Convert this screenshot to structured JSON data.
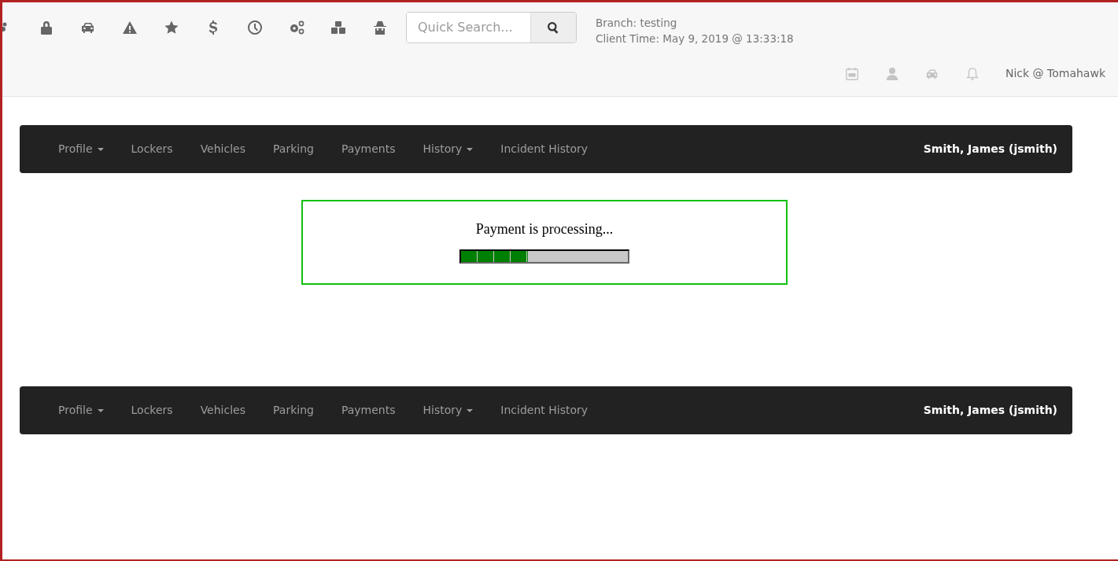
{
  "header": {
    "search": {
      "placeholder": "Quick Search..."
    },
    "branch": "Branch: testing",
    "client_time": "Client Time: May 9, 2019 @ 13:33:18",
    "user_menu": "Nick @ Tomahawk"
  },
  "navbars": [
    {
      "items": [
        {
          "label": "Profile",
          "dropdown": true
        },
        {
          "label": "Lockers",
          "dropdown": false
        },
        {
          "label": "Vehicles",
          "dropdown": false
        },
        {
          "label": "Parking",
          "dropdown": false
        },
        {
          "label": "Payments",
          "dropdown": false
        },
        {
          "label": "History",
          "dropdown": true
        },
        {
          "label": "Incident History",
          "dropdown": false
        }
      ],
      "user": "Smith, James (jsmith)"
    },
    {
      "items": [
        {
          "label": "Profile",
          "dropdown": true
        },
        {
          "label": "Lockers",
          "dropdown": false
        },
        {
          "label": "Vehicles",
          "dropdown": false
        },
        {
          "label": "Parking",
          "dropdown": false
        },
        {
          "label": "Payments",
          "dropdown": false
        },
        {
          "label": "History",
          "dropdown": true
        },
        {
          "label": "Incident History",
          "dropdown": false
        }
      ],
      "user": "Smith, James (jsmith)"
    }
  ],
  "processing": {
    "message": "Payment is processing...",
    "level": 0.4
  }
}
